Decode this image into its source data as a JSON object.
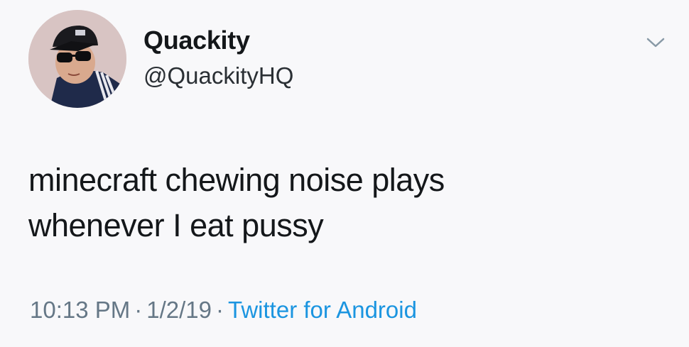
{
  "author": {
    "display_name": "Quackity",
    "handle": "@QuackityHQ"
  },
  "tweet": {
    "line1": "minecraft chewing noise plays",
    "line2": "whenever I eat pussy"
  },
  "meta": {
    "time": "10:13 PM",
    "separator": "·",
    "date": "1/2/19",
    "source": "Twitter for Android"
  },
  "icons": {
    "menu": "chevron-down-icon"
  },
  "colors": {
    "background": "#f8f8fa",
    "text": "#14171a",
    "secondary": "#657786",
    "link": "#1b95e0"
  }
}
